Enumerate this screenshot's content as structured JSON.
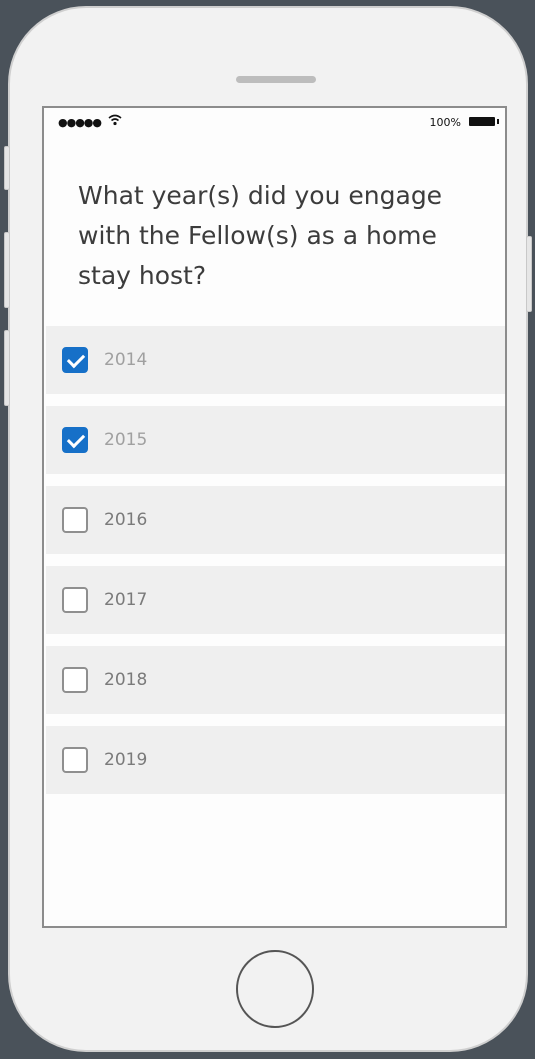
{
  "status_bar": {
    "signal": "●●●●●",
    "wifi_icon": "wifi-icon",
    "battery_percent": "100%",
    "battery_icon": "battery-icon"
  },
  "question": {
    "text": "What year(s) did you engage with the Fellow(s) as a home stay host?"
  },
  "options": [
    {
      "label": "2014",
      "checked": true
    },
    {
      "label": "2015",
      "checked": true
    },
    {
      "label": "2016",
      "checked": false
    },
    {
      "label": "2017",
      "checked": false
    },
    {
      "label": "2018",
      "checked": false
    },
    {
      "label": "2019",
      "checked": false
    }
  ],
  "colors": {
    "checkbox_checked": "#1670c8",
    "row_background": "#efefef",
    "frame_background": "#4a525a"
  }
}
